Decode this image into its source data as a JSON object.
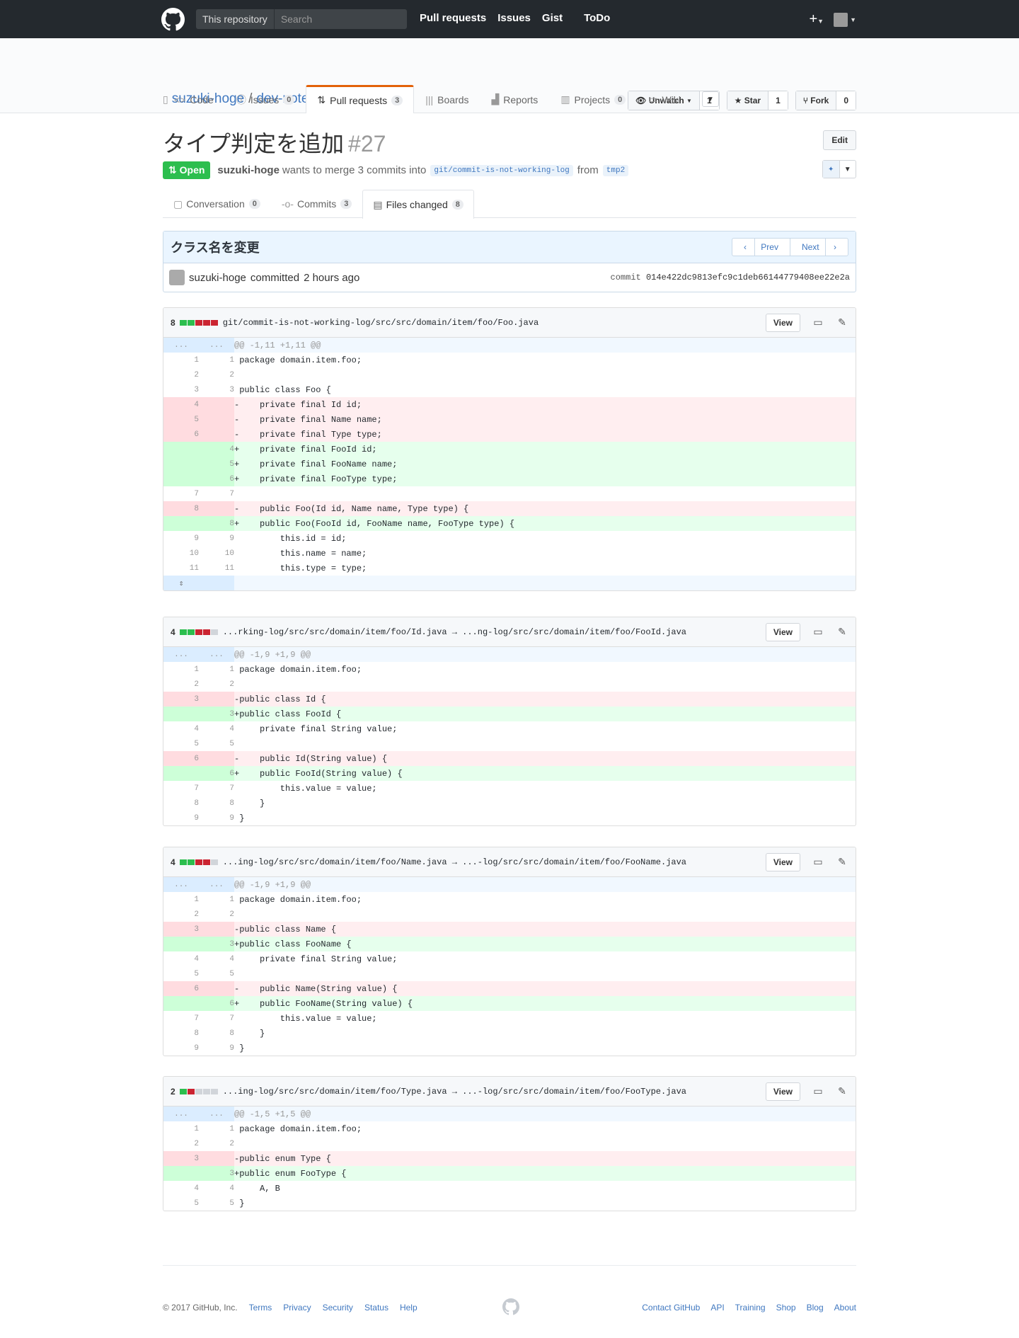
{
  "header": {
    "scope_label": "This repository",
    "search_placeholder": "Search",
    "nav": [
      "Pull requests",
      "Issues",
      "Gist",
      "ToDo"
    ],
    "plus": "+"
  },
  "repo": {
    "owner": "suzuki-hoge",
    "name": "dev-note",
    "watch_label": "Unwatch",
    "watch_count": "1",
    "star_label": "Star",
    "star_count": "1",
    "fork_label": "Fork",
    "fork_count": "0",
    "tabs": [
      {
        "label": "Code",
        "count": ""
      },
      {
        "label": "Issues",
        "count": "0"
      },
      {
        "label": "Pull requests",
        "count": "3"
      },
      {
        "label": "Boards",
        "count": ""
      },
      {
        "label": "Reports",
        "count": ""
      },
      {
        "label": "Projects",
        "count": "0"
      },
      {
        "label": "Wiki",
        "count": ""
      }
    ]
  },
  "pr": {
    "title": "タイプ判定を追加",
    "number": "#27",
    "edit_label": "Edit",
    "state": "Open",
    "author": "suzuki-hoge",
    "merge_text": "wants to merge 3 commits into",
    "base": "git/commit-is-not-working-log",
    "from": "from",
    "head": "tmp2",
    "tabs": [
      {
        "label": "Conversation",
        "count": "0"
      },
      {
        "label": "Commits",
        "count": "3"
      },
      {
        "label": "Files changed",
        "count": "8"
      }
    ]
  },
  "commit": {
    "message": "クラス名を変更",
    "prev": "Prev",
    "next": "Next",
    "author": "suzuki-hoge",
    "committed": "committed",
    "time": "2 hours ago",
    "sha_label": "commit",
    "sha": "014e422dc9813efc9c1deb66144779408ee22e2a"
  },
  "file_view_label": "View",
  "files": [
    {
      "count": "8",
      "blocks": [
        "a",
        "a",
        "d",
        "d",
        "d"
      ],
      "path": "git/commit-is-not-working-log/src/src/domain/item/foo/Foo.java"
    },
    {
      "count": "4",
      "blocks": [
        "a",
        "a",
        "d",
        "d",
        "n"
      ],
      "path": "...rking-log/src/src/domain/item/foo/Id.java → ...ng-log/src/src/domain/item/foo/FooId.java"
    },
    {
      "count": "4",
      "blocks": [
        "a",
        "a",
        "d",
        "d",
        "n"
      ],
      "path": "...ing-log/src/src/domain/item/foo/Name.java → ...-log/src/src/domain/item/foo/FooName.java"
    },
    {
      "count": "2",
      "blocks": [
        "a",
        "d",
        "n",
        "n",
        "n"
      ],
      "path": "...ing-log/src/src/domain/item/foo/Type.java → ...-log/src/src/domain/item/foo/FooType.java"
    }
  ],
  "diffs": [
    [
      [
        "hk",
        "...",
        "...",
        "@@ -1,11 +1,11 @@"
      ],
      [
        "ctx",
        "1",
        "1",
        " package domain.item.foo;"
      ],
      [
        "ctx",
        "2",
        "2",
        " "
      ],
      [
        "ctx",
        "3",
        "3",
        " public class Foo {"
      ],
      [
        "del",
        "4",
        "",
        "-    private final Id id;"
      ],
      [
        "del",
        "5",
        "",
        "-    private final Name name;"
      ],
      [
        "del",
        "6",
        "",
        "-    private final Type type;"
      ],
      [
        "add",
        "",
        "4",
        "+    private final FooId id;"
      ],
      [
        "add",
        "",
        "5",
        "+    private final FooName name;"
      ],
      [
        "add",
        "",
        "6",
        "+    private final FooType type;"
      ],
      [
        "ctx",
        "7",
        "7",
        " "
      ],
      [
        "del",
        "8",
        "",
        "-    public Foo(Id id, Name name, Type type) {"
      ],
      [
        "add",
        "",
        "8",
        "+    public Foo(FooId id, FooName name, FooType type) {"
      ],
      [
        "ctx",
        "9",
        "9",
        "         this.id = id;"
      ],
      [
        "ctx",
        "10",
        "10",
        "         this.name = name;"
      ],
      [
        "ctx",
        "11",
        "11",
        "         this.type = type;"
      ],
      [
        "ex",
        "⇕",
        "",
        ""
      ]
    ],
    [
      [
        "hk",
        "...",
        "...",
        "@@ -1,9 +1,9 @@"
      ],
      [
        "ctx",
        "1",
        "1",
        " package domain.item.foo;"
      ],
      [
        "ctx",
        "2",
        "2",
        " "
      ],
      [
        "del",
        "3",
        "",
        "-public class Id {"
      ],
      [
        "add",
        "",
        "3",
        "+public class FooId {"
      ],
      [
        "ctx",
        "4",
        "4",
        "     private final String value;"
      ],
      [
        "ctx",
        "5",
        "5",
        " "
      ],
      [
        "del",
        "6",
        "",
        "-    public Id(String value) {"
      ],
      [
        "add",
        "",
        "6",
        "+    public FooId(String value) {"
      ],
      [
        "ctx",
        "7",
        "7",
        "         this.value = value;"
      ],
      [
        "ctx",
        "8",
        "8",
        "     }"
      ],
      [
        "ctx",
        "9",
        "9",
        " }"
      ]
    ],
    [
      [
        "hk",
        "...",
        "...",
        "@@ -1,9 +1,9 @@"
      ],
      [
        "ctx",
        "1",
        "1",
        " package domain.item.foo;"
      ],
      [
        "ctx",
        "2",
        "2",
        " "
      ],
      [
        "del",
        "3",
        "",
        "-public class Name {"
      ],
      [
        "add",
        "",
        "3",
        "+public class FooName {"
      ],
      [
        "ctx",
        "4",
        "4",
        "     private final String value;"
      ],
      [
        "ctx",
        "5",
        "5",
        " "
      ],
      [
        "del",
        "6",
        "",
        "-    public Name(String value) {"
      ],
      [
        "add",
        "",
        "6",
        "+    public FooName(String value) {"
      ],
      [
        "ctx",
        "7",
        "7",
        "         this.value = value;"
      ],
      [
        "ctx",
        "8",
        "8",
        "     }"
      ],
      [
        "ctx",
        "9",
        "9",
        " }"
      ]
    ],
    [
      [
        "hk",
        "...",
        "...",
        "@@ -1,5 +1,5 @@"
      ],
      [
        "ctx",
        "1",
        "1",
        " package domain.item.foo;"
      ],
      [
        "ctx",
        "2",
        "2",
        " "
      ],
      [
        "del",
        "3",
        "",
        "-public enum Type {"
      ],
      [
        "add",
        "",
        "3",
        "+public enum FooType {"
      ],
      [
        "ctx",
        "4",
        "4",
        "     A, B"
      ],
      [
        "ctx",
        "5",
        "5",
        " }"
      ]
    ]
  ],
  "footer": {
    "copyright": "© 2017 GitHub, Inc.",
    "left_links": [
      "Terms",
      "Privacy",
      "Security",
      "Status",
      "Help"
    ],
    "right_links": [
      "Contact GitHub",
      "API",
      "Training",
      "Shop",
      "Blog",
      "About"
    ]
  },
  "colors": {
    "accent": "#4078c0",
    "open": "#2cbe4e",
    "tab_active": "#e36209"
  }
}
